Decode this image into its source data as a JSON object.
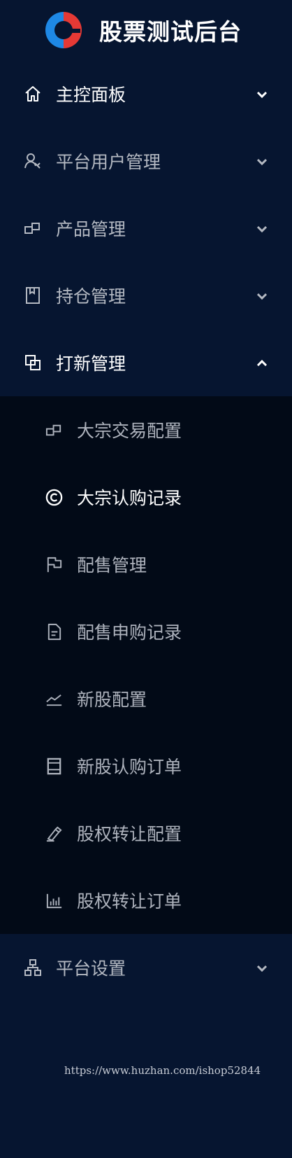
{
  "brand": {
    "title": "股票测试后台",
    "logo_icon": "logo-icon",
    "logo_colors": [
      "#e53935",
      "#1e88e5"
    ]
  },
  "menu": [
    {
      "label": "主控面板",
      "icon": "home-icon"
    },
    {
      "label": "平台用户管理",
      "icon": "users-icon"
    },
    {
      "label": "产品管理",
      "icon": "product-icon"
    },
    {
      "label": "持仓管理",
      "icon": "book-icon"
    },
    {
      "label": "打新管理",
      "icon": "stack-icon",
      "expanded": true,
      "children": [
        {
          "label": "大宗交易配置",
          "icon": "product-icon"
        },
        {
          "label": "大宗认购记录",
          "icon": "copyright-icon",
          "active": true
        },
        {
          "label": "配售管理",
          "icon": "flag-icon"
        },
        {
          "label": "配售申购记录",
          "icon": "document-icon"
        },
        {
          "label": "新股配置",
          "icon": "trend-icon"
        },
        {
          "label": "新股认购订单",
          "icon": "receipt-icon"
        },
        {
          "label": "股权转让配置",
          "icon": "pen-icon"
        },
        {
          "label": "股权转让订单",
          "icon": "bar-chart-icon"
        }
      ]
    },
    {
      "label": "平台设置",
      "icon": "sitemap-icon"
    }
  ],
  "watermark": "https://www.huzhan.com/ishop52844",
  "colors": {
    "background": "#061530",
    "submenu_background": "#020a17",
    "text": "#b4b9c2",
    "active_text": "#ffffff"
  }
}
